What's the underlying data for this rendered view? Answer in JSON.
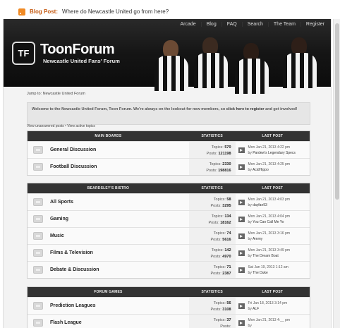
{
  "blog": {
    "icon": "rss-icon",
    "label": "Blog Post:",
    "title": "Where do Newcastle United go from here?"
  },
  "nav": [
    "Arcade",
    "Blog",
    "FAQ",
    "Search",
    "The Team",
    "Register"
  ],
  "logo": {
    "mark": "TF",
    "title": "ToonForum",
    "subtitle": "Newcastle United Fans' Forum"
  },
  "breadcrumb": "Jump to: Newcastle United Forum",
  "welcome": {
    "text": "Welcome to the Newcastle United Forum, Toon Forum. We're always on the lookout for new members, so ",
    "link": "click here to register",
    "tail": " and get involved!"
  },
  "quicklinks": "View unanswered posts • View active topics",
  "sections": [
    {
      "title": "MAIN BOARDS",
      "col_stats": "STATISTICS",
      "col_last": "LAST POST",
      "forums": [
        {
          "name": "General Discussion",
          "topics": "570",
          "posts": "121198",
          "date": "Mon Jan 21, 2013 4:22 pm",
          "by": "Pardew's Legendary Specs"
        },
        {
          "name": "Football Discussion",
          "topics": "2330",
          "posts": "198816",
          "date": "Mon Jan 21, 2013 4:25 pm",
          "by": "AcidHippo"
        }
      ]
    },
    {
      "title": "BEARDSLEY'S BISTRO",
      "col_stats": "STATISTICS",
      "col_last": "LAST POST",
      "forums": [
        {
          "name": "All Sports",
          "topics": "58",
          "posts": "3295",
          "date": "Mon Jan 21, 2013 4:03 pm",
          "by": "dayfan93"
        },
        {
          "name": "Gaming",
          "topics": "134",
          "posts": "18162",
          "date": "Mon Jan 21, 2013 4:04 pm",
          "by": "You Can Call Me Yo"
        },
        {
          "name": "Music",
          "topics": "74",
          "posts": "5616",
          "date": "Mon Jan 21, 2013 3:16 pm",
          "by": "Ammy"
        },
        {
          "name": "Films & Television",
          "topics": "142",
          "posts": "4970",
          "date": "Mon Jan 21, 2013 3:49 pm",
          "by": "The Dream Boat"
        },
        {
          "name": "Debate & Discussion",
          "topics": "71",
          "posts": "2387",
          "date": "Sat Jan 19, 2013 1:12 am",
          "by": "The Duke"
        }
      ]
    },
    {
      "title": "FORUM GAMES",
      "col_stats": "STATISTICS",
      "col_last": "LAST POST",
      "forums": [
        {
          "name": "Prediction Leagues",
          "topics": "56",
          "posts": "3108",
          "date": "Fri Jan 18, 2013 3:14 pm",
          "by": "ALF"
        },
        {
          "name": "Flash League",
          "topics": "37",
          "posts": "",
          "date": "Mon Jan 21, 2013 4:__ pm",
          "by": ""
        }
      ]
    }
  ]
}
